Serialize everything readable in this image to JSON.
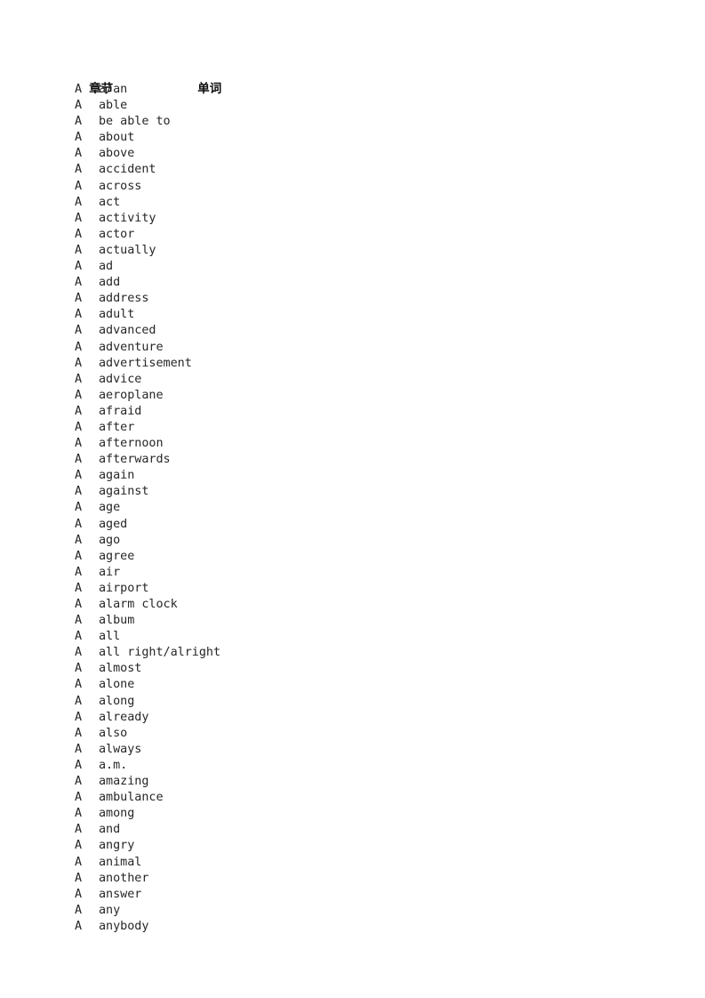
{
  "document": {
    "columns": {
      "chapter_header": "章节",
      "word_header": "单词"
    },
    "rows": [
      {
        "chapter": "A",
        "word": "a/an"
      },
      {
        "chapter": "A",
        "word": "able"
      },
      {
        "chapter": "A",
        "word": "be able to"
      },
      {
        "chapter": "A",
        "word": "about"
      },
      {
        "chapter": "A",
        "word": "above"
      },
      {
        "chapter": "A",
        "word": "accident"
      },
      {
        "chapter": "A",
        "word": "across"
      },
      {
        "chapter": "A",
        "word": "act"
      },
      {
        "chapter": "A",
        "word": "activity"
      },
      {
        "chapter": "A",
        "word": "actor"
      },
      {
        "chapter": "A",
        "word": "actually"
      },
      {
        "chapter": "A",
        "word": "ad"
      },
      {
        "chapter": "A",
        "word": "add"
      },
      {
        "chapter": "A",
        "word": "address"
      },
      {
        "chapter": "A",
        "word": "adult"
      },
      {
        "chapter": "A",
        "word": "advanced"
      },
      {
        "chapter": "A",
        "word": "adventure"
      },
      {
        "chapter": "A",
        "word": "advertisement"
      },
      {
        "chapter": "A",
        "word": "advice"
      },
      {
        "chapter": "A",
        "word": "aeroplane"
      },
      {
        "chapter": "A",
        "word": "afraid"
      },
      {
        "chapter": "A",
        "word": "after"
      },
      {
        "chapter": "A",
        "word": "afternoon"
      },
      {
        "chapter": "A",
        "word": "afterwards"
      },
      {
        "chapter": "A",
        "word": "again"
      },
      {
        "chapter": "A",
        "word": "against"
      },
      {
        "chapter": "A",
        "word": "age"
      },
      {
        "chapter": "A",
        "word": "aged"
      },
      {
        "chapter": "A",
        "word": "ago"
      },
      {
        "chapter": "A",
        "word": "agree"
      },
      {
        "chapter": "A",
        "word": "air"
      },
      {
        "chapter": "A",
        "word": "airport"
      },
      {
        "chapter": "A",
        "word": "alarm clock"
      },
      {
        "chapter": "A",
        "word": "album"
      },
      {
        "chapter": "A",
        "word": "all"
      },
      {
        "chapter": "A",
        "word": "all right/alright"
      },
      {
        "chapter": "A",
        "word": "almost"
      },
      {
        "chapter": "A",
        "word": "alone"
      },
      {
        "chapter": "A",
        "word": "along"
      },
      {
        "chapter": "A",
        "word": "already"
      },
      {
        "chapter": "A",
        "word": "also"
      },
      {
        "chapter": "A",
        "word": "always"
      },
      {
        "chapter": "A",
        "word": "a.m."
      },
      {
        "chapter": "A",
        "word": "amazing"
      },
      {
        "chapter": "A",
        "word": "ambulance"
      },
      {
        "chapter": "A",
        "word": "among"
      },
      {
        "chapter": "A",
        "word": "and"
      },
      {
        "chapter": "A",
        "word": "angry"
      },
      {
        "chapter": "A",
        "word": "animal"
      },
      {
        "chapter": "A",
        "word": "another"
      },
      {
        "chapter": "A",
        "word": "answer"
      },
      {
        "chapter": "A",
        "word": "any"
      },
      {
        "chapter": "A",
        "word": "anybody"
      }
    ]
  }
}
